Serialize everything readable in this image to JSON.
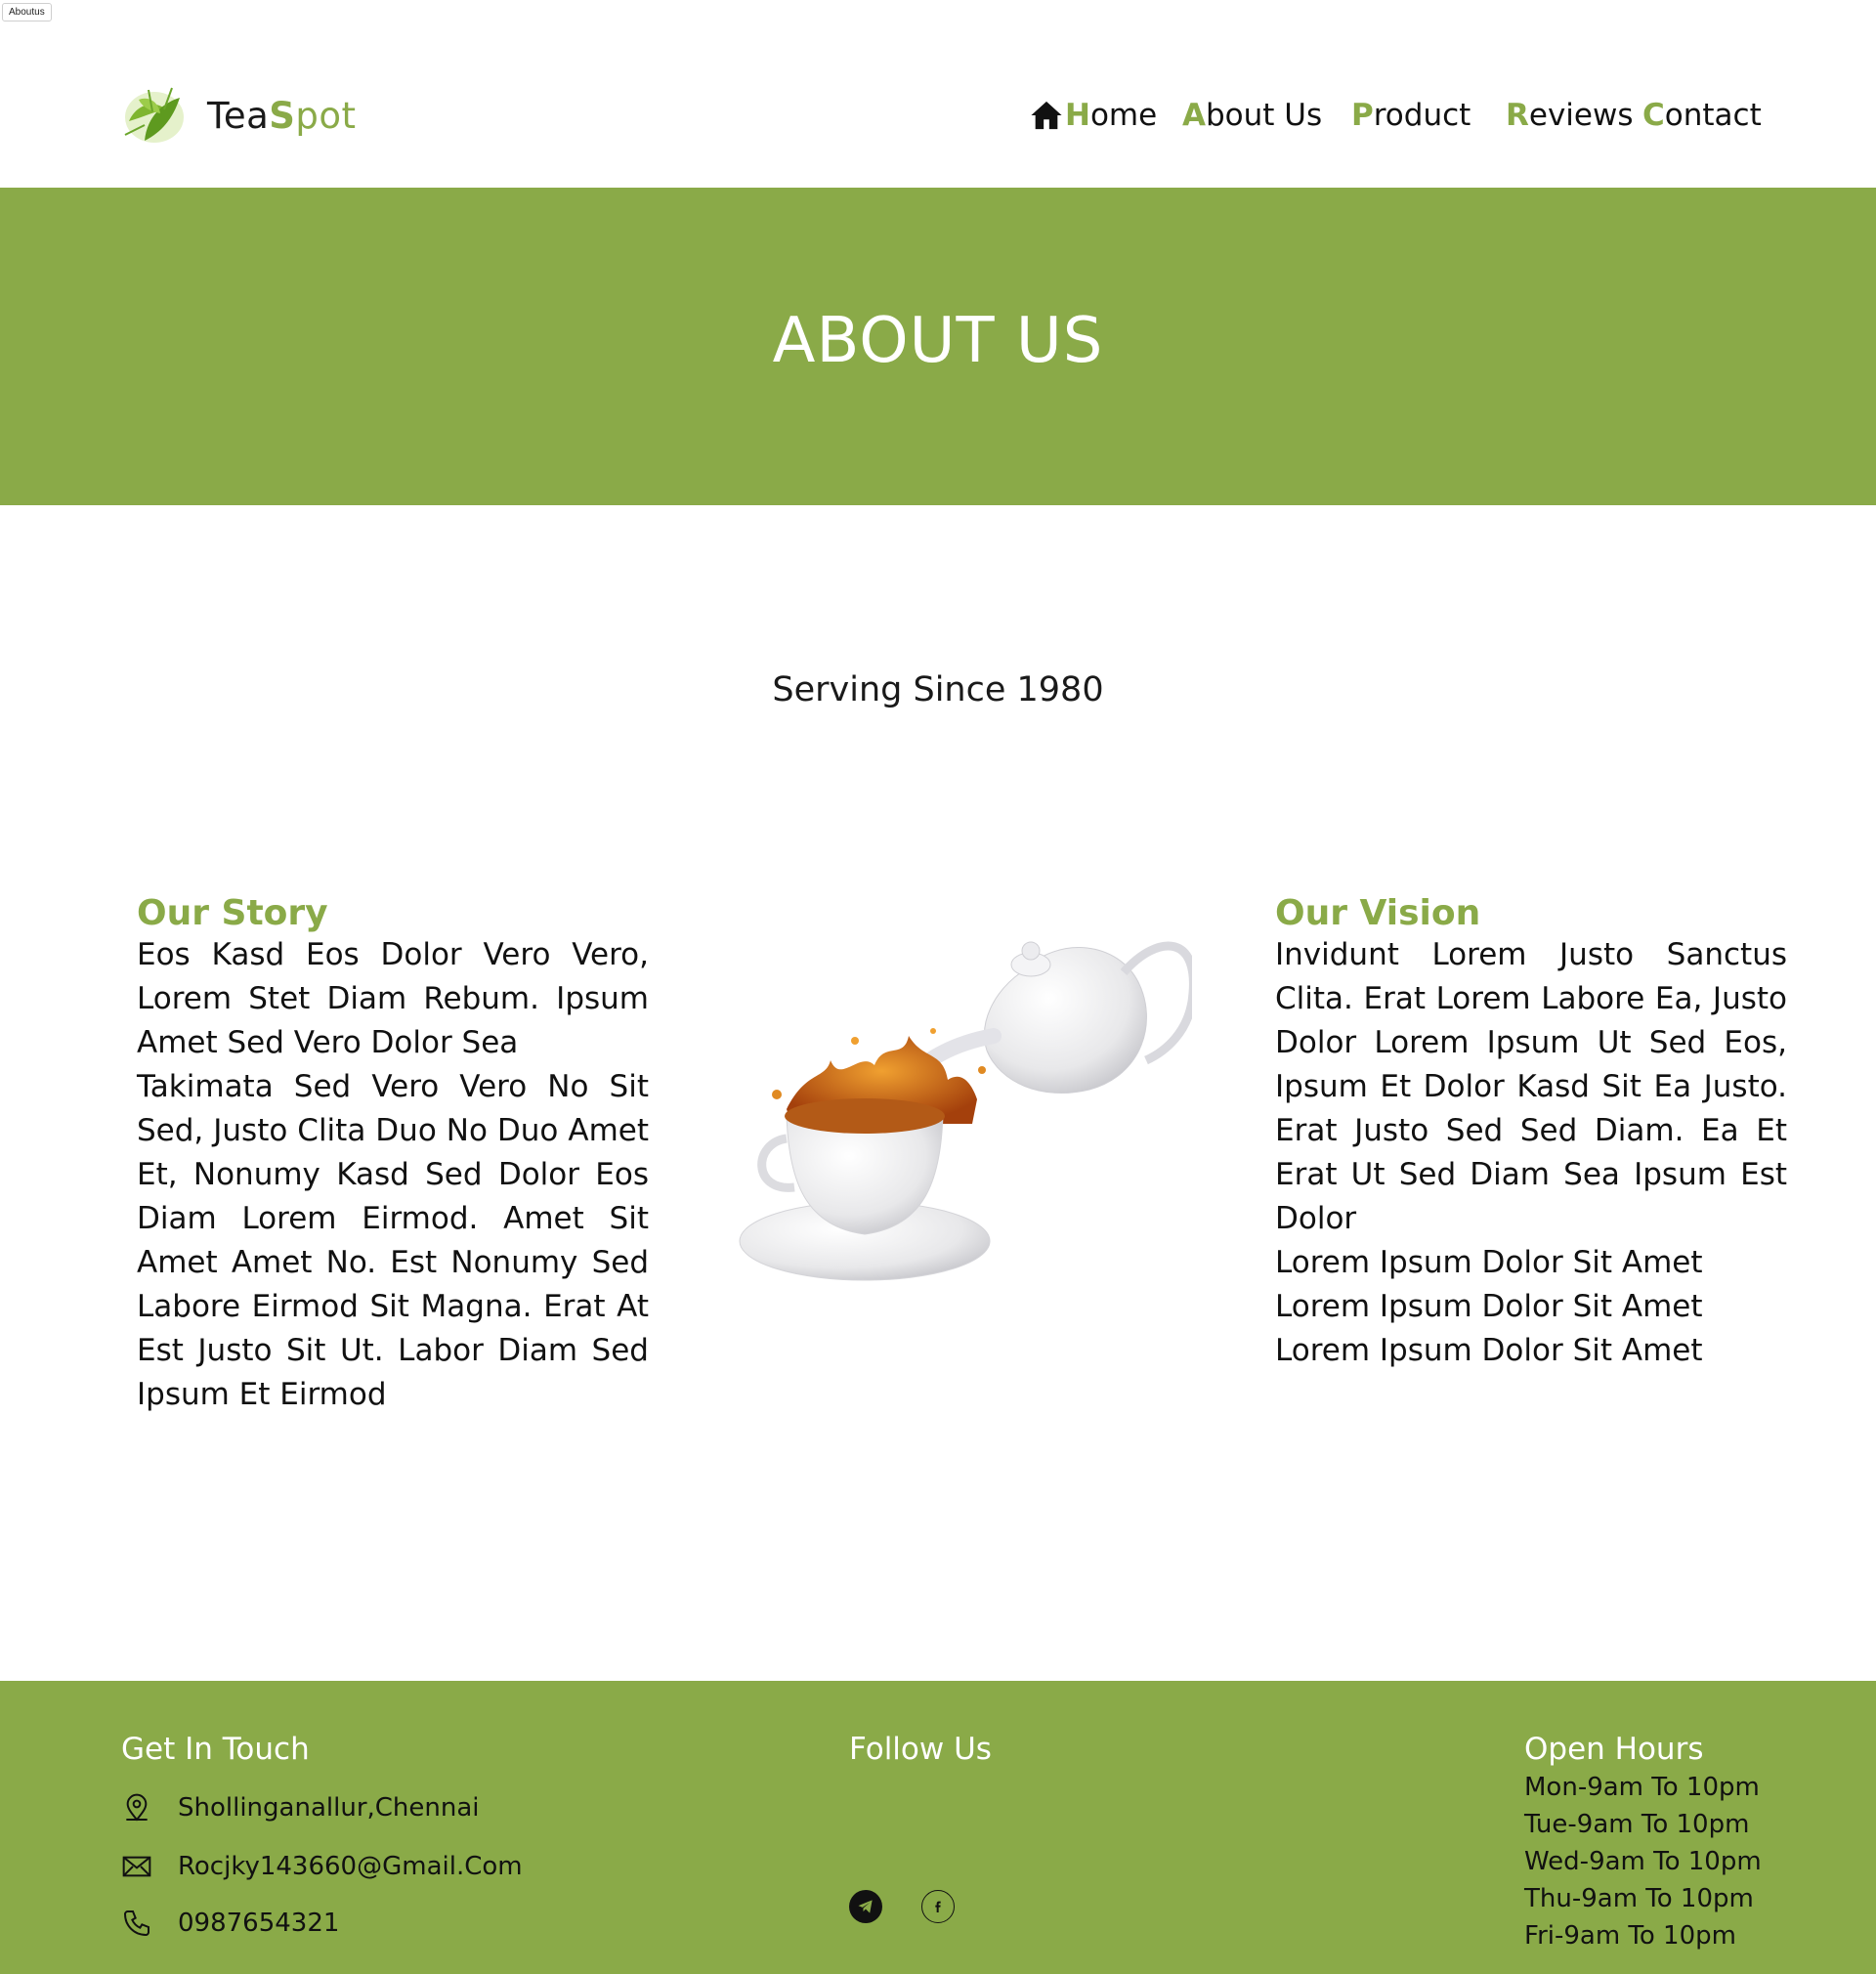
{
  "tab": {
    "label": "Aboutus"
  },
  "brand": {
    "name_part1": "Tea",
    "name_part2_first": "S",
    "name_part2_rest": "pot"
  },
  "nav": {
    "items": [
      {
        "first": "H",
        "rest": "ome"
      },
      {
        "first": "A",
        "rest": "bout Us"
      },
      {
        "first": "P",
        "rest": "roduct"
      },
      {
        "first": "R",
        "rest": "eviews"
      },
      {
        "first": "C",
        "rest": "ontact"
      }
    ]
  },
  "hero": {
    "title": "ABOUT US"
  },
  "intro": {
    "serving_since": "Serving Since 1980"
  },
  "story": {
    "title": "Our Story",
    "paragraphs": [
      "Eos Kasd Eos Dolor Vero Vero, Lorem Stet Diam Rebum. Ipsum Amet Sed Vero Dolor Sea",
      "Takimata Sed Vero Vero No Sit Sed, Justo Clita Duo No Duo Amet Et, Nonumy Kasd Sed Dolor Eos Diam Lorem Eirmod. Amet Sit Amet Amet No. Est Nonumy Sed Labore Eirmod Sit Magna. Erat At Est Justo Sit Ut. Labor Diam Sed Ipsum Et Eirmod"
    ]
  },
  "vision": {
    "title": "Our Vision",
    "paragraph": "Invidunt Lorem Justo Sanctus Clita. Erat Lorem Labore Ea, Justo Dolor Lorem Ipsum Ut Sed Eos, Ipsum Et Dolor Kasd Sit Ea Justo. Erat Justo Sed Sed Diam. Ea Et Erat Ut Sed Diam Sea Ipsum Est Dolor",
    "lines": [
      "Lorem Ipsum Dolor Sit Amet",
      "Lorem Ipsum Dolor Sit Amet",
      "Lorem Ipsum Dolor Sit Amet"
    ]
  },
  "footer": {
    "get_in_touch": {
      "title": "Get In Touch",
      "address": "Shollinganallur,Chennai",
      "email": "Rocjky143660@Gmail.Com",
      "phone": "0987654321",
      "icons": [
        "location-icon",
        "mail-icon",
        "phone-icon"
      ]
    },
    "follow_us": {
      "title": "Follow Us",
      "icons": [
        "telegram-icon",
        "facebook-icon"
      ]
    },
    "open_hours": {
      "title": "Open Hours",
      "rows": [
        "Mon-9am To 10pm",
        "Tue-9am To 10pm",
        "Wed-9am To 10pm",
        "Thu-9am To 10pm",
        "Fri-9am To 10pm"
      ]
    }
  },
  "colors": {
    "accent": "#8aaa48",
    "text": "#111111",
    "background": "#ffffff"
  }
}
